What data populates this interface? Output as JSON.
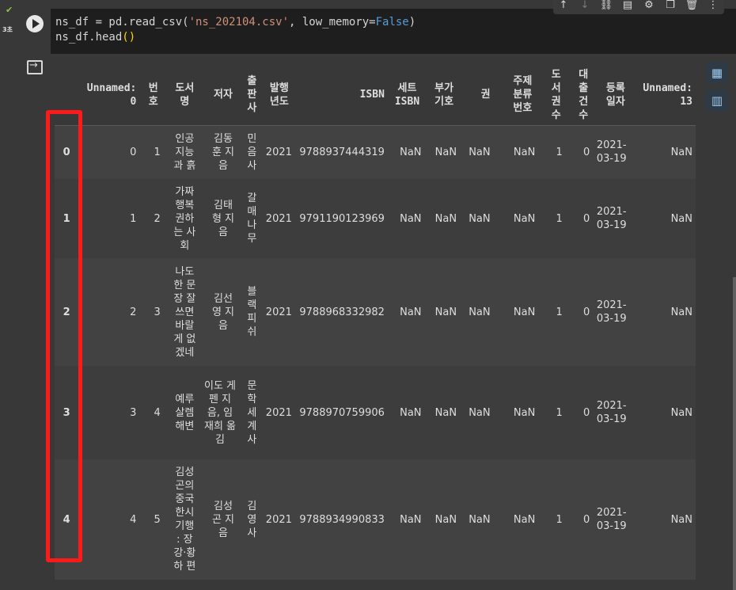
{
  "cell": {
    "exec_time": "3초",
    "code_line1_pre": "ns_df = pd.read_csv(",
    "code_line1_str": "'ns_202104.csv'",
    "code_line1_mid": ", low_memory=",
    "code_line1_kw": "False",
    "code_line1_post": ")",
    "code_line2_pre": "ns_df.head",
    "code_line2_paren": "()"
  },
  "toolbar": {
    "icons": [
      "arrow-up-icon",
      "arrow-down-icon",
      "link-icon",
      "comment-icon",
      "gear-icon",
      "mirror-cell-icon",
      "trash-icon",
      "more-icon"
    ]
  },
  "table": {
    "columns": [
      "",
      "Unnamed: 0",
      "번호",
      "도서명",
      "저자",
      "출판사",
      "발행년도",
      "ISBN",
      "세트 ISBN",
      "부가기호",
      "권",
      "주제분류번호",
      "도서권수",
      "대출건수",
      "등록일자",
      "Unnamed: 13"
    ],
    "rows": [
      {
        "idx": "0",
        "unnamed0": "0",
        "no": "1",
        "title": "인공지능과 흙",
        "author": "김동훈 지음",
        "publisher": "민음사",
        "year": "2021",
        "isbn": "9788937444319",
        "set_isbn": "NaN",
        "addl": "NaN",
        "vol": "NaN",
        "subject": "NaN",
        "copies": "1",
        "loans": "0",
        "reg_date": "2021-03-19",
        "unnamed13": "NaN"
      },
      {
        "idx": "1",
        "unnamed0": "1",
        "no": "2",
        "title": "가짜 행복 권하는 사회",
        "author": "김태형 지음",
        "publisher": "갈매나무",
        "year": "2021",
        "isbn": "9791190123969",
        "set_isbn": "NaN",
        "addl": "NaN",
        "vol": "NaN",
        "subject": "NaN",
        "copies": "1",
        "loans": "0",
        "reg_date": "2021-03-19",
        "unnamed13": "NaN"
      },
      {
        "idx": "2",
        "unnamed0": "2",
        "no": "3",
        "title": "나도 한 문장 잘 쓰면 바랄 게 없겠네",
        "author": "김선영 지음",
        "publisher": "블랙피쉬",
        "year": "2021",
        "isbn": "9788968332982",
        "set_isbn": "NaN",
        "addl": "NaN",
        "vol": "NaN",
        "subject": "NaN",
        "copies": "1",
        "loans": "0",
        "reg_date": "2021-03-19",
        "unnamed13": "NaN"
      },
      {
        "idx": "3",
        "unnamed0": "3",
        "no": "4",
        "title": "예루살렘 해변",
        "author": "이도 게펜 지음, 임재희 옮김",
        "publisher": "문학세계사",
        "year": "2021",
        "isbn": "9788970759906",
        "set_isbn": "NaN",
        "addl": "NaN",
        "vol": "NaN",
        "subject": "NaN",
        "copies": "1",
        "loans": "0",
        "reg_date": "2021-03-19",
        "unnamed13": "NaN"
      },
      {
        "idx": "4",
        "unnamed0": "4",
        "no": "5",
        "title": "김성곤의 중국한시기행 : 장강·황하 편",
        "author": "김성곤 지음",
        "publisher": "김영사",
        "year": "2021",
        "isbn": "9788934990833",
        "set_isbn": "NaN",
        "addl": "NaN",
        "vol": "NaN",
        "subject": "NaN",
        "copies": "1",
        "loans": "0",
        "reg_date": "2021-03-19",
        "unnamed13": "NaN"
      }
    ]
  },
  "side_buttons": [
    "table-icon",
    "chart-icon"
  ],
  "colors": {
    "highlight": "#ff1a1a",
    "string": "#ce9178",
    "keyword": "#569cd6"
  }
}
